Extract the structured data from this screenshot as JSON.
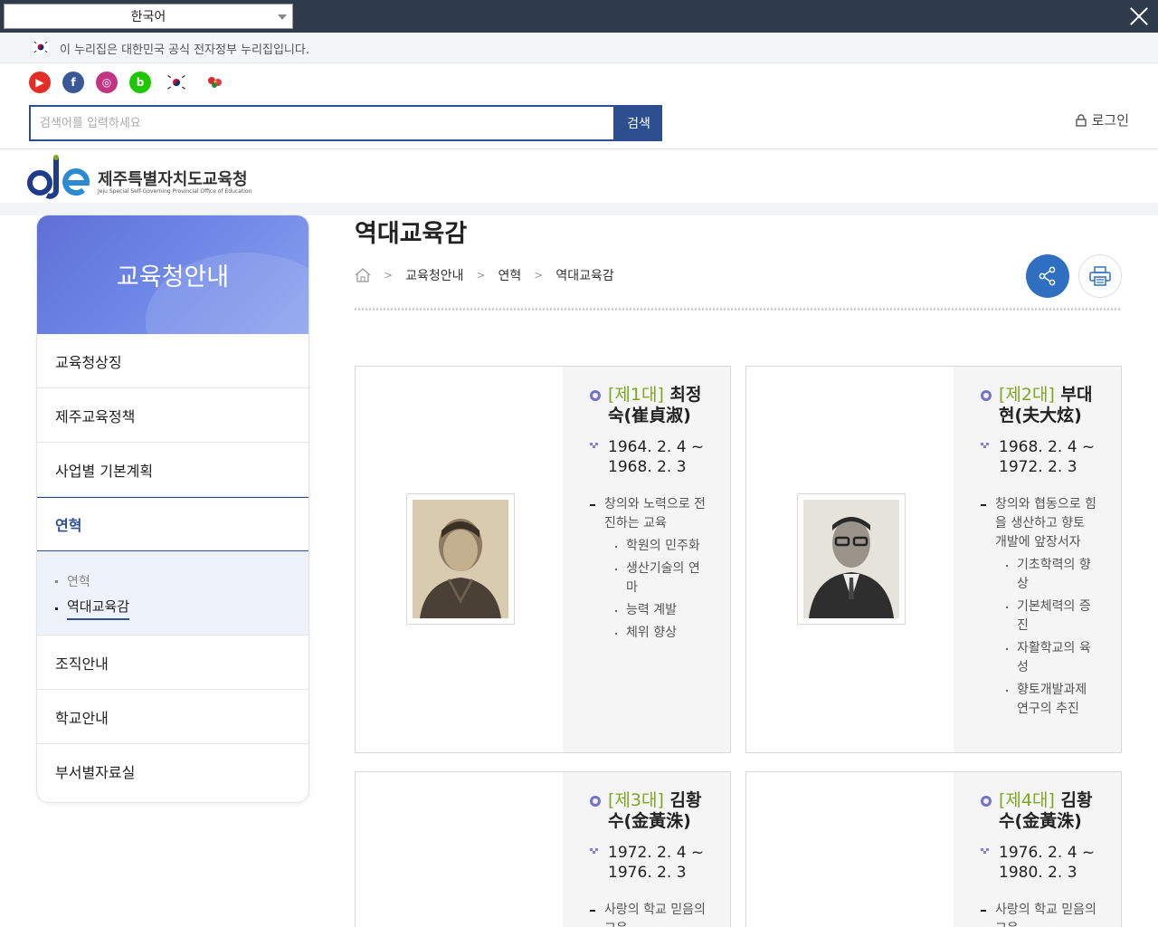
{
  "lang": {
    "selected": "한국어"
  },
  "gov_notice": "이 누리집은 대한민국 공식 전자정부 누리집입니다.",
  "sns": [
    {
      "name": "youtube",
      "glyph": "▶"
    },
    {
      "name": "facebook",
      "glyph": "f"
    },
    {
      "name": "instagram",
      "glyph": "◎"
    },
    {
      "name": "blog",
      "glyph": "b"
    }
  ],
  "search": {
    "placeholder": "검색어를 입력하세요",
    "button": "검색"
  },
  "login": "로그인",
  "logo": {
    "name": "제주특별자치도교육청",
    "eng": "Jeju Special Self-Governing Provincial Office of Education"
  },
  "lnb": {
    "title": "교육청안내",
    "items": [
      {
        "label": "교육청상징"
      },
      {
        "label": "제주교육정책"
      },
      {
        "label": "사업별 기본계획"
      },
      {
        "label": "연혁"
      },
      {
        "label": "조직안내"
      },
      {
        "label": "학교안내"
      },
      {
        "label": "부서별자료실"
      }
    ],
    "sub": [
      {
        "label": "연혁"
      },
      {
        "label": "역대교육감"
      }
    ]
  },
  "page": {
    "title": "역대교육감",
    "breadcrumb": [
      "교육청안내",
      "연혁",
      "역대교육감"
    ]
  },
  "cards": [
    {
      "gen": "[제1대]",
      "name": "최정숙(崔貞淑)",
      "period1": "1964. 2. 4 ~",
      "period2": "1968. 2. 3",
      "motto": "창의와 노력으로 전진하는 교육",
      "points": [
        "학원의 민주화",
        "생산기술의 연마",
        "능력 계발",
        "체위 향상"
      ]
    },
    {
      "gen": "[제2대]",
      "name": "부대현(夫大炫)",
      "period1": "1968. 2. 4 ~",
      "period2": "1972. 2. 3",
      "motto": "창의와 협동으로 힘을 생산하고 향토 개발에 앞장서자",
      "points": [
        "기초학력의 향상",
        "기본체력의 증진",
        "자활학교의 육성",
        "향토개발과제 연구의 추진"
      ]
    },
    {
      "gen": "[제3대]",
      "name": "김황수(金黃洙)",
      "period1": "1972. 2. 4 ~",
      "period2": "1976. 2. 3",
      "motto": "사랑의 학교 믿음의 교육",
      "points": []
    },
    {
      "gen": "[제4대]",
      "name": "김황수(金黃洙)",
      "period1": "1976. 2. 4 ~",
      "period2": "1980. 2. 3",
      "motto": "사랑의 학교 믿음의 교육",
      "points": []
    }
  ]
}
